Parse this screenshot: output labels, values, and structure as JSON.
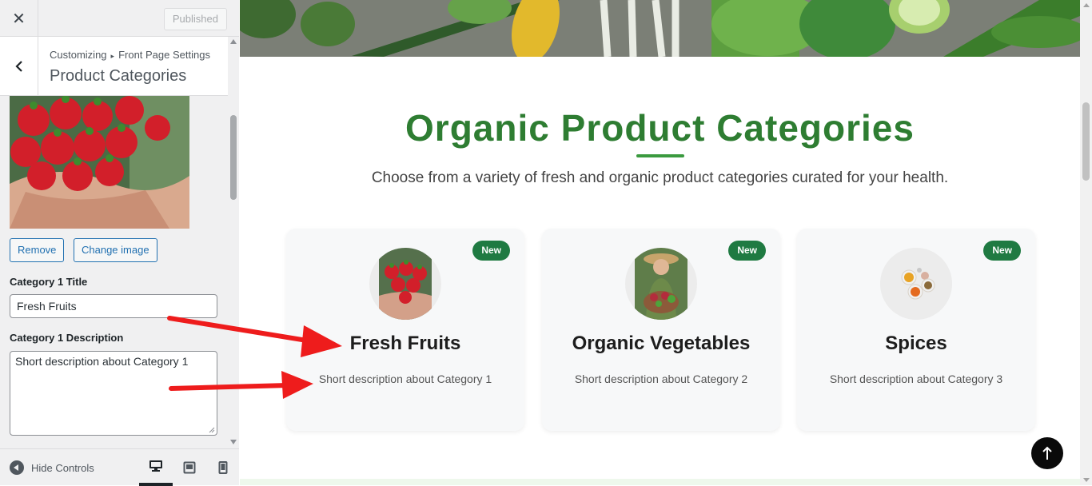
{
  "topbar": {
    "close_label": "✕",
    "published_label": "Published"
  },
  "section": {
    "breadcrumb_root": "Customizing",
    "breadcrumb_separator": "▸",
    "breadcrumb_parent": "Front Page Settings",
    "title": "Product Categories"
  },
  "image_controls": {
    "remove_label": "Remove",
    "change_label": "Change image"
  },
  "fields": {
    "title_label": "Category 1 Title",
    "title_value": "Fresh Fruits",
    "desc_label": "Category 1 Description",
    "desc_value": "Short description about Category 1"
  },
  "footer": {
    "hide_controls_label": "Hide Controls",
    "devices": [
      "desktop-icon",
      "tablet-icon",
      "mobile-icon"
    ],
    "active_device": "desktop"
  },
  "preview": {
    "heading": "Organic Product Categories",
    "subheading": "Choose from a variety of fresh and organic product categories curated for your health.",
    "accent_color": "#2e7d32",
    "badge_color": "#1f7a42",
    "cards": [
      {
        "badge": "New",
        "title": "Fresh Fruits",
        "description": "Short description about Category 1",
        "image": "strawberries-image"
      },
      {
        "badge": "New",
        "title": "Organic Vegetables",
        "description": "Short description about Category 2",
        "image": "farmer-vegetables-image"
      },
      {
        "badge": "New",
        "title": "Spices",
        "description": "Short description about Category 3",
        "image": "spices-bowls-image"
      }
    ],
    "scroll_top_icon": "arrow-up-icon"
  }
}
